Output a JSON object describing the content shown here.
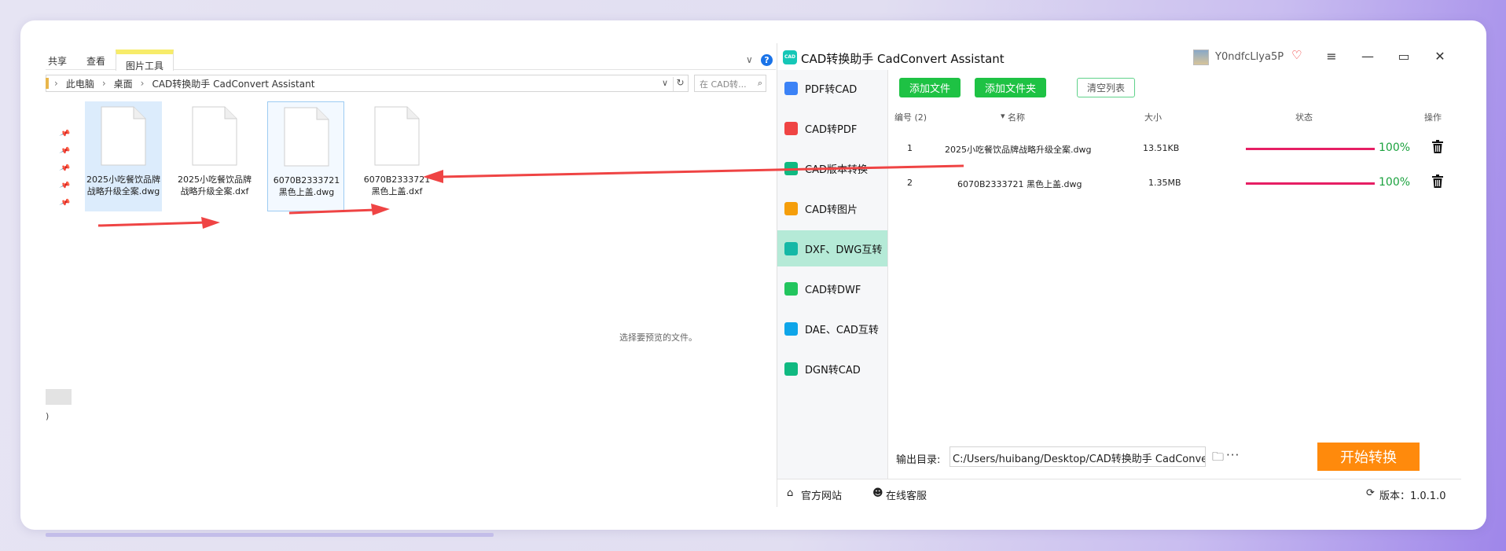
{
  "explorer": {
    "ribbon_tabs": [
      "共享",
      "查看",
      "图片工具"
    ],
    "breadcrumb": [
      "此电脑",
      "桌面",
      "CAD转换助手 CadConvert Assistant"
    ],
    "search_placeholder": "在 CAD转...",
    "files": [
      {
        "name": "2025小吃餐饮品牌战略升级全案.dwg"
      },
      {
        "name": "2025小吃餐饮品牌战略升级全案.dxf"
      },
      {
        "name": "6070B2333721 黑色上盖.dwg"
      },
      {
        "name": "6070B2333721 黑色上盖.dxf"
      }
    ],
    "preview_text": "选择要预览的文件。",
    "left_stub": ")"
  },
  "app": {
    "title": "CAD转换助手 CadConvert Assistant",
    "logo_text": "CAD",
    "username": "Y0ndfcLlya5P",
    "nav": [
      {
        "label": "PDF转CAD",
        "color": "#3b82f6"
      },
      {
        "label": "CAD转PDF",
        "color": "#ef4444"
      },
      {
        "label": "CAD版本转换",
        "color": "#10b981"
      },
      {
        "label": "CAD转图片",
        "color": "#f59e0b"
      },
      {
        "label": "DXF、DWG互转",
        "color": "#14b8a6"
      },
      {
        "label": "CAD转DWF",
        "color": "#22c55e"
      },
      {
        "label": "DAE、CAD互转",
        "color": "#0ea5e9"
      },
      {
        "label": "DGN转CAD",
        "color": "#10b981"
      }
    ],
    "active_nav_index": 4,
    "toolbar": {
      "add_file": "添加文件",
      "add_folder": "添加文件夹",
      "clear_list": "清空列表"
    },
    "table": {
      "headers": {
        "index": "编号 (2)",
        "name": "名称",
        "size": "大小",
        "status": "状态",
        "action": "操作"
      },
      "rows": [
        {
          "index": "1",
          "name": "2025小吃餐饮品牌战略升级全案.dwg",
          "size": "13.51KB",
          "progress": 1.0,
          "progress_text": "100%"
        },
        {
          "index": "2",
          "name": "6070B2333721 黑色上盖.dwg",
          "size": "1.35MB",
          "progress": 1.0,
          "progress_text": "100%"
        }
      ]
    },
    "output": {
      "label": "输出目录:",
      "path": "C:/Users/huibang/Desktop/CAD转换助手 CadConvert Assistant",
      "more": "···"
    },
    "start_button": "开始转换",
    "footer": {
      "website": "官方网站",
      "support": "在线客服",
      "version": "版本：1.0.1.0"
    },
    "colors": {
      "green": "#1ec244",
      "orange": "#ff8a0c",
      "progress": "#e61f64",
      "active_nav": "#b5ead7",
      "arrow": "#ef4444"
    }
  }
}
